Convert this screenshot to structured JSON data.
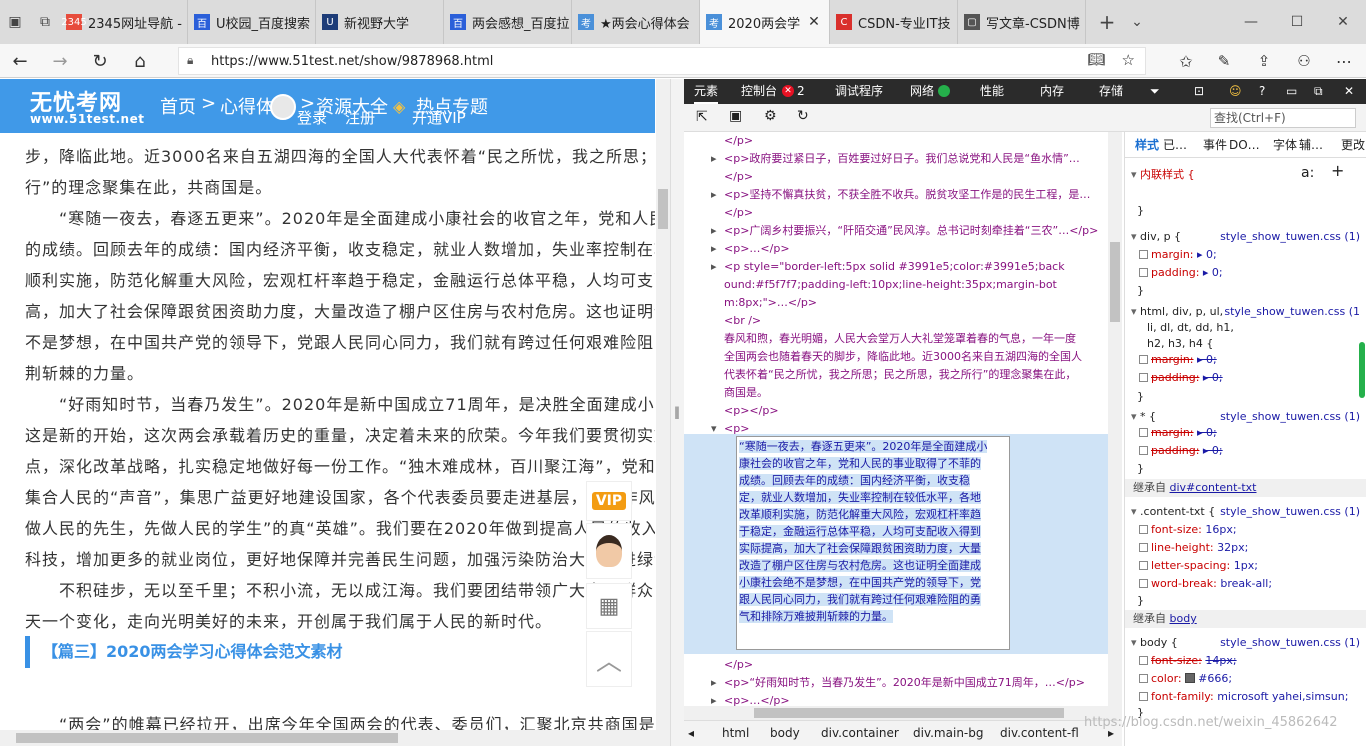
{
  "tabs": [
    {
      "label": "2345网址导航 -",
      "fav_color": "#e74c3c",
      "fav_text": "2345"
    },
    {
      "label": "U校园_百度搜索",
      "fav_color": "#2b5fd9",
      "fav_text": "百"
    },
    {
      "label": "新视野大学",
      "fav_color": "#1d3c78",
      "fav_text": "U"
    },
    {
      "label": "两会感想_百度拉",
      "fav_color": "#2b5fd9",
      "fav_text": "百"
    },
    {
      "label": "★两会心得体会",
      "fav_color": "#4a90d9",
      "fav_text": "考"
    },
    {
      "label": "2020两会学",
      "fav_color": "#4a90d9",
      "fav_text": "考"
    },
    {
      "label": "CSDN-专业IT技",
      "fav_color": "#d9302c",
      "fav_text": "C"
    },
    {
      "label": "写文章-CSDN博",
      "fav_color": "#555555",
      "fav_text": "▢"
    }
  ],
  "address": {
    "url": "https://www.51test.net/show/9878968.html"
  },
  "site": {
    "logo": "无忧考网",
    "logo_sub": "www.51test.net",
    "nav_home": "首页",
    "nav_sep1": ">",
    "nav_cat": "心得体会",
    "nav_sep2": ">",
    "nav_res": "资源大全",
    "nav_hot": "热点专题",
    "login": "登录",
    "register": "注册",
    "vip": "开通VIP"
  },
  "article": {
    "lines": [
      "步，降临此地。近3000名来自五湖四海的全国人大代表怀着“民之所忧，我之所思；民之所思，我之所",
      "行”的理念聚集在此，共商国是。",
      "　　“寒随一夜去，春逐五更来”。2020年是全面建成小康社会的收官之年，党和人民的事业取得了不菲",
      "的成绩。回顾去年的成绩：国内经济平衡，收支稳定，就业人数增加，失业率控制在较低水平，各地改革",
      "顺利实施，防范化解重大风险，宏观杠杆率趋于稳定，金融运行总体平稳，人均可支配收入得到实际提",
      "高，加大了社会保障跟贫困资助力度，大量改造了棚户区住房与农村危房。这也证明全面建成小康社会绝",
      "不是梦想，在中国共产党的领导下，党跟人民同心同力，我们就有跨过任何艰难险阻的勇气和排除万难披",
      "荆斩棘的力量。",
      "　　“好雨知时节，当春乃发生”。2020年是新中国成立71周年，是决胜全面建成小康社会的关键之年，",
      "这是新的开始，这次两会承载着历史的重量，决定着未来的欣荣。今年我们要贯彻实施新发展理念，抓重",
      "点，深化改革战略，扎实稳定地做好每一份工作。“独木难成林，百川聚江海”，党和人民要团结一致，",
      "集合人民的“声音”，集思广益更好地建设国家，各个代表委员要走进基层，锤炼作风，真正做到“先",
      "做人民的先生，先做人民的学生”的真“英雄”。我们要在2020年做到提高人民的收入水平，加强发展",
      "科技，增加更多的就业岗位，更好地保障并完善民生问题，加强污染防治大力推进绿色发展。",
      "　　不积硅步，无以至千里；不积小流，无以成江海。我们要团结带领广大人民群众，一步一个脚印，一",
      "天一个变化，走向光明美好的未来，开创属于我们属于人民的新时代。"
    ],
    "section_title": "【篇三】2020两会学习心得体会范文素材",
    "next_line": "　　“两会”的帷幕已经拉开，出席今年全国两会的代表、委员们，汇聚北京共商国是"
  },
  "sidebar_float": {
    "vip": "VIP"
  },
  "devtools": {
    "tabs": [
      "元素",
      "控制台",
      "调试程序",
      "网络",
      "性能",
      "内存",
      "存储"
    ],
    "console_errors": "2",
    "search_placeholder": "查找(Ctrl+F)",
    "dom_lines": [
      {
        "t": "</p>",
        "indent": "  "
      },
      {
        "t": "<p>政府要过紧日子，百姓要过好日子。我们总说党和人民是“鱼水情”…",
        "indent": "▸ "
      },
      {
        "t": "</p>",
        "indent": "  "
      },
      {
        "t": "<p>坚持不懈真扶贫，不获全胜不收兵。脱贫攻坚工作是的民生工程，是…",
        "indent": "▸ "
      },
      {
        "t": "</p>",
        "indent": "  "
      },
      {
        "t": "<p>广阔乡村要振兴，“阡陌交通”民风淳。总书记时刻牵挂着“三农”…</p>",
        "indent": "▸ "
      },
      {
        "t": "<p>…</p>",
        "indent": "▸ "
      },
      {
        "t": "<p style=\"border-left:5px solid #3991e5;color:#3991e5;back",
        "indent": "▸ "
      },
      {
        "t": "ound:#f5f7f7;padding-left:10px;line-height:35px;margin-bot",
        "indent": "  "
      },
      {
        "t": "m:8px;\">…</p>",
        "indent": "  "
      },
      {
        "t": "<br />",
        "indent": "  "
      },
      {
        "t": "春风和煦，春光明媚，人民大会堂万人大礼堂笼罩着春的气息，一年一度",
        "indent": "  "
      },
      {
        "t": "全国两会也随着春天的脚步，降临此地。近3000名来自五湖四海的全国人",
        "indent": "  "
      },
      {
        "t": "代表怀着“民之所忧，我之所思；民之所思，我之所行”的理念聚集在此，",
        "indent": "  "
      },
      {
        "t": "商国是。",
        "indent": "  "
      },
      {
        "t": "<p></p>",
        "indent": "  "
      },
      {
        "t": "<p>",
        "indent": "▾ "
      }
    ],
    "selected_text": [
      "“寒随一夜去，春逐五更来”。2020年是全面建成小",
      "康社会的收官之年，党和人民的事业取得了不菲的",
      "成绩。回顾去年的成绩：国内经济平衡，收支稳",
      "定，就业人数增加，失业率控制在较低水平，各地",
      "改革顺利实施，防范化解重大风险，宏观杠杆率趋",
      "于稳定，金融运行总体平稳，人均可支配收入得到",
      "实际提高，加大了社会保障跟贫困资助力度，大量",
      "改造了棚户区住房与农村危房。这也证明全面建成",
      "小康社会绝不是梦想，在中国共产党的领导下，党",
      "跟人民同心同力，我们就有跨过任何艰难险阻的勇",
      "气和排除万难披荆斩棘的力量。"
    ],
    "dom_after": [
      {
        "t": "</p>",
        "indent": "  "
      },
      {
        "t": "<p>“好雨知时节，当春乃发生”。2020年是新中国成立71周年，…</p>",
        "indent": "▸ "
      },
      {
        "t": "<p>…</p>",
        "indent": "▸ "
      }
    ],
    "crumbs": [
      "html",
      "body",
      "div.container",
      "div.main-bg",
      "div.content-fl"
    ],
    "styles_tabs": [
      "样式",
      "已…",
      "事件",
      "DO…",
      "字体",
      "辅…",
      "更改"
    ],
    "inline_style": "内联样式 {",
    "rule_close": "}",
    "rules": [
      {
        "sel": "div, p {",
        "src": "style_show_tuwen.css (1)"
      },
      {
        "sel": "html, div, p, ul,",
        "sel2": "li, dl, dt, dd, h1,",
        "sel3": "h2, h3, h4 {",
        "src": "style_show_tuwen.css (1"
      },
      {
        "sel": "* {",
        "src": "style_show_tuwen.css (1)"
      }
    ],
    "props_div_p": [
      {
        "n": "margin:",
        "v": "▸ 0;"
      },
      {
        "n": "padding:",
        "v": "▸ 0;"
      }
    ],
    "props_html": [
      {
        "n": "margin:",
        "v": "▸ 0;"
      },
      {
        "n": "padding:",
        "v": "▸ 0;"
      }
    ],
    "props_star": [
      {
        "n": "margin:",
        "v": "▸ 0;"
      },
      {
        "n": "padding:",
        "v": "▸ 0;"
      }
    ],
    "inherit1_label": "继承自",
    "inherit1_target": "div#content-txt",
    "content_txt_sel": ".content-txt {",
    "content_txt_src": "style_show_tuwen.css (1)",
    "props_content": [
      {
        "n": "font-size:",
        "v": "16px;"
      },
      {
        "n": "line-height:",
        "v": "32px;"
      },
      {
        "n": "letter-spacing:",
        "v": "1px;"
      },
      {
        "n": "word-break:",
        "v": "break-all;"
      }
    ],
    "inherit2_label": "继承自",
    "inherit2_target": "body",
    "body_sel": "body {",
    "body_src": "style_show_tuwen.css (1)",
    "props_body": [
      {
        "n": "font-size:",
        "v": "14px;"
      },
      {
        "n": "color:",
        "v": "#666;"
      },
      {
        "n": "font-family:",
        "v": "microsoft yahei,simsun;"
      }
    ],
    "watermark": "https://blog.csdn.net/weixin_45862642"
  }
}
